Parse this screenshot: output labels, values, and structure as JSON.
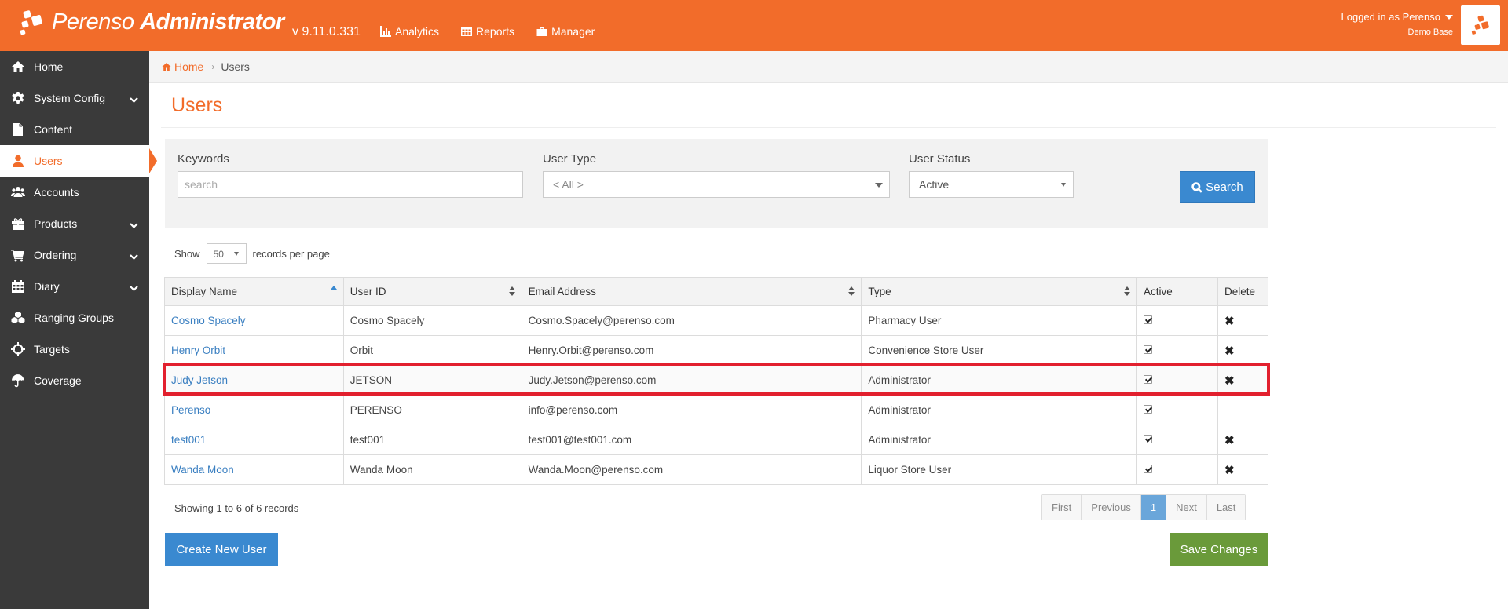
{
  "app": {
    "brand_light": "Perenso",
    "brand_bold": "Administrator",
    "version": "v 9.11.0.331",
    "accent_color": "#f26c2a"
  },
  "topnav": [
    {
      "label": "Analytics",
      "icon": "bar-chart-icon"
    },
    {
      "label": "Reports",
      "icon": "table-icon"
    },
    {
      "label": "Manager",
      "icon": "briefcase-icon"
    }
  ],
  "login": {
    "status": "Logged in as Perenso",
    "database": "Demo Base"
  },
  "sidebar": {
    "items": [
      {
        "label": "Home",
        "icon": "home-icon",
        "expandable": false
      },
      {
        "label": "System Config",
        "icon": "gear-icon",
        "expandable": true
      },
      {
        "label": "Content",
        "icon": "file-icon",
        "expandable": false
      },
      {
        "label": "Users",
        "icon": "user-icon",
        "expandable": false,
        "active": true
      },
      {
        "label": "Accounts",
        "icon": "users-icon",
        "expandable": false
      },
      {
        "label": "Products",
        "icon": "gift-icon",
        "expandable": true
      },
      {
        "label": "Ordering",
        "icon": "cart-icon",
        "expandable": true
      },
      {
        "label": "Diary",
        "icon": "calendar-icon",
        "expandable": true
      },
      {
        "label": "Ranging Groups",
        "icon": "cubes-icon",
        "expandable": false
      },
      {
        "label": "Targets",
        "icon": "crosshairs-icon",
        "expandable": false
      },
      {
        "label": "Coverage",
        "icon": "umbrella-icon",
        "expandable": false
      }
    ]
  },
  "breadcrumb": {
    "home": "Home",
    "current": "Users"
  },
  "page": {
    "title": "Users"
  },
  "filters": {
    "keywords_label": "Keywords",
    "keywords_placeholder": "search",
    "keywords_value": "",
    "user_type_label": "User Type",
    "user_type_value": "< All >",
    "user_status_label": "User Status",
    "user_status_value": "Active",
    "search_label": "Search"
  },
  "paging": {
    "show_label": "Show",
    "page_size": "50",
    "per_page_label": "records per page",
    "summary": "Showing 1 to 6 of 6 records",
    "buttons": [
      "First",
      "Previous",
      "1",
      "Next",
      "Last"
    ],
    "current_page": "1"
  },
  "table": {
    "columns": [
      "Display Name",
      "User ID",
      "Email Address",
      "Type",
      "Active",
      "Delete"
    ],
    "rows": [
      {
        "display_name": "Cosmo Spacely",
        "user_id": "Cosmo Spacely",
        "email": "Cosmo.Spacely@perenso.com",
        "type": "Pharmacy User",
        "active": true,
        "deletable": true
      },
      {
        "display_name": "Henry Orbit",
        "user_id": "Orbit",
        "email": "Henry.Orbit@perenso.com",
        "type": "Convenience Store User",
        "active": true,
        "deletable": true
      },
      {
        "display_name": "Judy Jetson",
        "user_id": "JETSON",
        "email": "Judy.Jetson@perenso.com",
        "type": "Administrator",
        "active": true,
        "deletable": true,
        "highlighted": true
      },
      {
        "display_name": "Perenso",
        "user_id": "PERENSO",
        "email": "info@perenso.com",
        "type": "Administrator",
        "active": true,
        "deletable": false
      },
      {
        "display_name": "test001",
        "user_id": "test001",
        "email": "test001@test001.com",
        "type": "Administrator",
        "active": true,
        "deletable": true
      },
      {
        "display_name": "Wanda Moon",
        "user_id": "Wanda Moon",
        "email": "Wanda.Moon@perenso.com",
        "type": "Liquor Store User",
        "active": true,
        "deletable": true
      }
    ]
  },
  "actions": {
    "create_label": "Create New User",
    "save_label": "Save Changes"
  }
}
